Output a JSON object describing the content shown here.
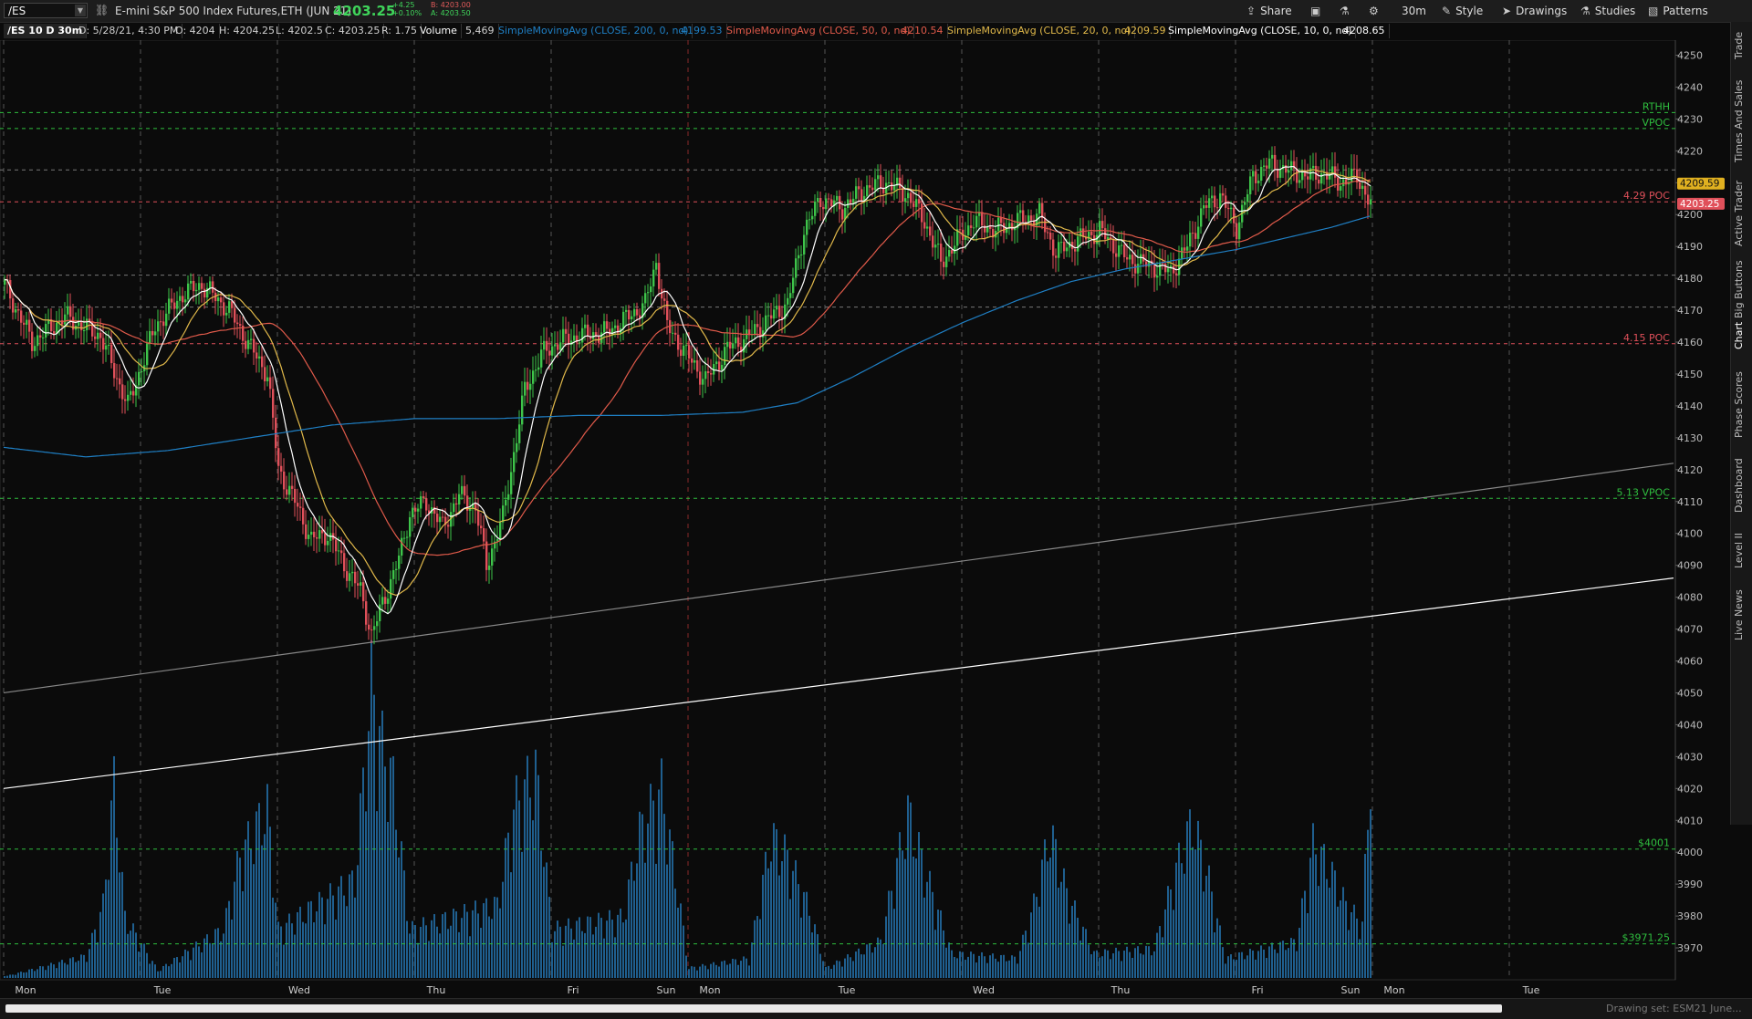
{
  "toolbar": {
    "symbol": "/ES",
    "instrument": "E-mini S&P 500 Index Futures,ETH (JUN 21)",
    "last_price": "4203.25",
    "change": "+4.25",
    "change_pct": "+0.10%",
    "bid": "B: 4203.00",
    "ask": "A: 4203.50",
    "share": "Share",
    "timeframe": "30m",
    "style": "Style",
    "drawings": "Drawings",
    "studies": "Studies",
    "patterns": "Patterns"
  },
  "header": {
    "period": "/ES 10 D 30m",
    "date": "D: 5/28/21, 4:30 PM",
    "open": "O: 4204",
    "high": "H: 4204.25",
    "low": "L: 4202.5",
    "close": "C: 4203.25",
    "range": "R: 1.75",
    "volume_label": "Volume",
    "volume_value": "5,469",
    "sma200_label": "SimpleMovingAvg (CLOSE, 200, 0, no)",
    "sma200_value": "4199.53",
    "sma50_label": "SimpleMovingAvg (CLOSE, 50, 0, no)",
    "sma50_value": "4210.54",
    "sma20_label": "SimpleMovingAvg (CLOSE, 20, 0, no)",
    "sma20_value": "4209.59",
    "sma10_label": "SimpleMovingAvg (CLOSE, 10, 0, no)",
    "sma10_value": "4208.65"
  },
  "sidebar": {
    "tabs": [
      "Trade",
      "Times And Sales",
      "Active Trader",
      "Big Buttons",
      "Chart",
      "Phase Scores",
      "Dashboard",
      "Level II",
      "Live News"
    ]
  },
  "status": {
    "drawing_set": "Drawing set: ESM21 June..."
  },
  "colors": {
    "up": "#3ec44a",
    "down": "#e0505a",
    "sma200": "#1f7fc4",
    "sma50": "#e05a4a",
    "sma20": "#e0b84a",
    "sma10": "#ffffff",
    "volume": "#1f5f8f",
    "level_green": "#2fbf3f",
    "level_red": "#e0505a",
    "price_badge_last": "#e0505a",
    "price_badge_sma20": "#e0b020"
  },
  "chart_data": {
    "type": "candlestick",
    "symbol": "/ES",
    "timeframe": "30m",
    "ylim": [
      3960,
      4253
    ],
    "y_ticks": [
      3970,
      3980,
      3990,
      4000,
      4010,
      4020,
      4030,
      4040,
      4050,
      4060,
      4070,
      4080,
      4090,
      4100,
      4110,
      4120,
      4130,
      4140,
      4150,
      4160,
      4170,
      4180,
      4190,
      4200,
      4210,
      4220,
      4230,
      4240,
      4250
    ],
    "x_labels": [
      "Mon",
      "Tue",
      "Wed",
      "Thu",
      "Fri",
      "Sun",
      "Mon",
      "Tue",
      "Wed",
      "Thu",
      "Fri",
      "Sun",
      "Mon",
      "Tue"
    ],
    "x_label_index": [
      8,
      58,
      108,
      158,
      208,
      242,
      258,
      308,
      358,
      408,
      458,
      492,
      508,
      558
    ],
    "day_separator_index": [
      0,
      50,
      100,
      150,
      200,
      250,
      300,
      350,
      400,
      450,
      500,
      550
    ],
    "highlight_separator_index": 250,
    "last_bar_index": 499,
    "total_slots": 610,
    "keypoints": [
      [
        0,
        4178
      ],
      [
        10,
        4160
      ],
      [
        22,
        4168
      ],
      [
        35,
        4162
      ],
      [
        45,
        4140
      ],
      [
        55,
        4165
      ],
      [
        65,
        4175
      ],
      [
        72,
        4178
      ],
      [
        82,
        4170
      ],
      [
        90,
        4158
      ],
      [
        96,
        4150
      ],
      [
        100,
        4120
      ],
      [
        106,
        4110
      ],
      [
        112,
        4098
      ],
      [
        118,
        4100
      ],
      [
        124,
        4090
      ],
      [
        130,
        4082
      ],
      [
        134,
        4068
      ],
      [
        138,
        4078
      ],
      [
        144,
        4092
      ],
      [
        148,
        4106
      ],
      [
        154,
        4110
      ],
      [
        160,
        4102
      ],
      [
        166,
        4112
      ],
      [
        172,
        4108
      ],
      [
        176,
        4090
      ],
      [
        182,
        4105
      ],
      [
        186,
        4125
      ],
      [
        190,
        4145
      ],
      [
        196,
        4156
      ],
      [
        202,
        4160
      ],
      [
        210,
        4162
      ],
      [
        220,
        4163
      ],
      [
        228,
        4168
      ],
      [
        234,
        4172
      ],
      [
        238,
        4185
      ],
      [
        242,
        4165
      ],
      [
        250,
        4155
      ],
      [
        256,
        4148
      ],
      [
        264,
        4158
      ],
      [
        272,
        4162
      ],
      [
        280,
        4168
      ],
      [
        286,
        4172
      ],
      [
        292,
        4195
      ],
      [
        298,
        4205
      ],
      [
        306,
        4202
      ],
      [
        314,
        4208
      ],
      [
        322,
        4210
      ],
      [
        330,
        4206
      ],
      [
        336,
        4198
      ],
      [
        342,
        4185
      ],
      [
        348,
        4192
      ],
      [
        354,
        4198
      ],
      [
        362,
        4195
      ],
      [
        370,
        4198
      ],
      [
        378,
        4200
      ],
      [
        384,
        4188
      ],
      [
        392,
        4192
      ],
      [
        400,
        4195
      ],
      [
        410,
        4186
      ],
      [
        418,
        4184
      ],
      [
        426,
        4182
      ],
      [
        432,
        4190
      ],
      [
        438,
        4202
      ],
      [
        444,
        4206
      ],
      [
        450,
        4196
      ],
      [
        456,
        4212
      ],
      [
        462,
        4216
      ],
      [
        468,
        4214
      ],
      [
        476,
        4212
      ],
      [
        482,
        4213
      ],
      [
        488,
        4210
      ],
      [
        494,
        4212
      ],
      [
        499,
        4203.25
      ]
    ],
    "volume_keypoints": [
      [
        0,
        60
      ],
      [
        30,
        900
      ],
      [
        36,
        3000
      ],
      [
        40,
        8000
      ],
      [
        44,
        2500
      ],
      [
        56,
        300
      ],
      [
        80,
        2000
      ],
      [
        86,
        5000
      ],
      [
        96,
        7000
      ],
      [
        100,
        2000
      ],
      [
        128,
        4000
      ],
      [
        134,
        12000
      ],
      [
        138,
        9500
      ],
      [
        142,
        8000
      ],
      [
        148,
        2000
      ],
      [
        180,
        3000
      ],
      [
        186,
        7000
      ],
      [
        194,
        8500
      ],
      [
        200,
        2000
      ],
      [
        226,
        2500
      ],
      [
        232,
        6000
      ],
      [
        240,
        7800
      ],
      [
        246,
        3500
      ],
      [
        250,
        400
      ],
      [
        272,
        800
      ],
      [
        280,
        5800
      ],
      [
        286,
        5000
      ],
      [
        294,
        2800
      ],
      [
        300,
        400
      ],
      [
        320,
        1500
      ],
      [
        330,
        6800
      ],
      [
        336,
        4500
      ],
      [
        346,
        1000
      ],
      [
        370,
        800
      ],
      [
        376,
        3000
      ],
      [
        382,
        6000
      ],
      [
        388,
        3500
      ],
      [
        398,
        1000
      ],
      [
        420,
        1200
      ],
      [
        428,
        4500
      ],
      [
        434,
        6500
      ],
      [
        440,
        4000
      ],
      [
        446,
        800
      ],
      [
        472,
        1500
      ],
      [
        478,
        5500
      ],
      [
        484,
        4500
      ],
      [
        490,
        3000
      ],
      [
        496,
        2200
      ],
      [
        499,
        8900
      ],
      [
        500,
        0
      ]
    ],
    "volume_ylim": [
      0,
      11000
    ],
    "sma_period": [
      10,
      20,
      50,
      200
    ],
    "sma200_keypoints": [
      [
        0,
        4127
      ],
      [
        30,
        4124
      ],
      [
        60,
        4126
      ],
      [
        90,
        4130
      ],
      [
        120,
        4134
      ],
      [
        150,
        4136
      ],
      [
        180,
        4136
      ],
      [
        210,
        4137
      ],
      [
        240,
        4137
      ],
      [
        270,
        4138
      ],
      [
        290,
        4141
      ],
      [
        310,
        4149
      ],
      [
        330,
        4158
      ],
      [
        350,
        4166
      ],
      [
        370,
        4173
      ],
      [
        390,
        4179
      ],
      [
        410,
        4183
      ],
      [
        430,
        4186
      ],
      [
        450,
        4189
      ],
      [
        470,
        4193
      ],
      [
        485,
        4196
      ],
      [
        499,
        4199.5
      ]
    ],
    "levels": [
      {
        "label": "RTHH",
        "value": 4232,
        "color": "green"
      },
      {
        "label": "VPOC",
        "value": 4227,
        "color": "green"
      },
      {
        "label": "",
        "value": 4214,
        "color": "grey"
      },
      {
        "label": "4.29 POC",
        "value": 4204,
        "color": "red"
      },
      {
        "label": "",
        "value": 4181,
        "color": "grey"
      },
      {
        "label": "",
        "value": 4171,
        "color": "grey"
      },
      {
        "label": "4.15 POC",
        "value": 4159.5,
        "color": "red"
      },
      {
        "label": "5.13 VPOC",
        "value": 4111,
        "color": "green"
      },
      {
        "label": "$4001",
        "value": 4001,
        "color": "green"
      },
      {
        "label": "$3971.25",
        "value": 3971.25,
        "color": "green"
      }
    ],
    "trendlines": [
      {
        "color": "#888888",
        "from": [
          0,
          4050
        ],
        "to": [
          610,
          4122
        ]
      },
      {
        "color": "#ffffff",
        "from": [
          0,
          4020
        ],
        "to": [
          610,
          4086
        ]
      }
    ],
    "price_badges": [
      {
        "value": 4209.59,
        "label": "4209.59",
        "color": "yellow"
      },
      {
        "value": 4203.25,
        "label": "4203.25",
        "color": "red"
      }
    ]
  }
}
